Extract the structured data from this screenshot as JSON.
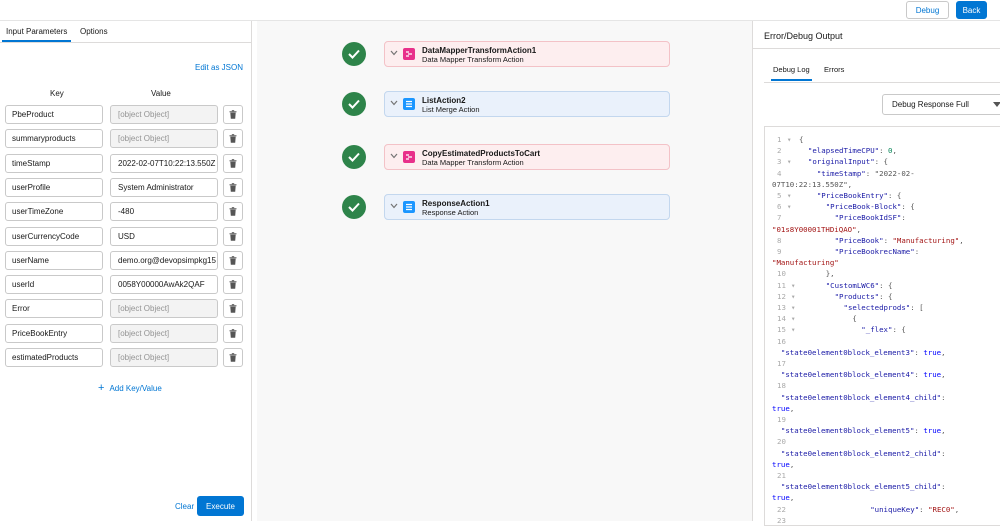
{
  "topbar": {
    "debug_label": "Debug",
    "back_label": "Back"
  },
  "left": {
    "tabs": [
      "Input Parameters",
      "Options"
    ],
    "edit_json": "Edit as JSON",
    "key_header": "Key",
    "value_header": "Value",
    "rows": [
      {
        "key": "PbeProduct",
        "value": "[object Object]"
      },
      {
        "key": "summaryproducts",
        "value": "[object Object]"
      },
      {
        "key": "timeStamp",
        "value": "2022-02-07T10:22:13.550Z"
      },
      {
        "key": "userProfile",
        "value": "System Administrator"
      },
      {
        "key": "userTimeZone",
        "value": "-480"
      },
      {
        "key": "userCurrencyCode",
        "value": "USD"
      },
      {
        "key": "userName",
        "value": "demo.org@devopsimpkg15"
      },
      {
        "key": "userId",
        "value": "0058Y00000AwAk2QAF"
      },
      {
        "key": "Error",
        "value": "[object Object]"
      },
      {
        "key": "PriceBookEntry",
        "value": "[object Object]"
      },
      {
        "key": "estimatedProducts",
        "value": "[object Object]"
      }
    ],
    "add_label": "Add Key/Value",
    "clear_label": "Clear",
    "execute_label": "Execute"
  },
  "steps": [
    {
      "title": "DataMapperTransformAction1",
      "subtitle": "Data Mapper Transform Action",
      "kind": "pink"
    },
    {
      "title": "ListAction2",
      "subtitle": "List Merge Action",
      "kind": "blue"
    },
    {
      "title": "CopyEstimatedProductsToCart",
      "subtitle": "Data Mapper Transform Action",
      "kind": "pink"
    },
    {
      "title": "ResponseAction1",
      "subtitle": "Response Action",
      "kind": "blue"
    }
  ],
  "right": {
    "title": "Error/Debug Output",
    "tabs": [
      "Debug Log",
      "Errors"
    ],
    "select_value": "Debug Response Full",
    "code": [
      {
        "n": "1",
        "f": "▾",
        "t": "{"
      },
      {
        "n": "2",
        "f": "",
        "t": "  \"elapsedTimeCPU\": 0,"
      },
      {
        "n": "3",
        "f": "▾",
        "t": "  \"originalInput\": {"
      },
      {
        "n": "4",
        "f": "",
        "t": "    \"timeStamp\": \"2022-02-"
      },
      {
        "n": "",
        "f": "",
        "t": "07T10:22:13.550Z\","
      },
      {
        "n": "5",
        "f": "▾",
        "t": "    \"PriceBookEntry\": {"
      },
      {
        "n": "6",
        "f": "▾",
        "t": "      \"PriceBook-Block\": {"
      },
      {
        "n": "7",
        "f": "",
        "t": "        \"PriceBookIdSF\":"
      },
      {
        "n": "",
        "f": "",
        "t": "\"01s8Y00001THDiQAO\","
      },
      {
        "n": "8",
        "f": "",
        "t": "        \"PriceBook\": \"Manufacturing\","
      },
      {
        "n": "9",
        "f": "",
        "t": "        \"PriceBookrecName\":"
      },
      {
        "n": "",
        "f": "",
        "t": "\"Manufacturing\""
      },
      {
        "n": "10",
        "f": "",
        "t": "      },"
      },
      {
        "n": "11",
        "f": "▾",
        "t": "      \"CustomLWC6\": {"
      },
      {
        "n": "12",
        "f": "▾",
        "t": "        \"Products\": {"
      },
      {
        "n": "13",
        "f": "▾",
        "t": "          \"selectedprods\": ["
      },
      {
        "n": "14",
        "f": "▾",
        "t": "            {"
      },
      {
        "n": "15",
        "f": "▾",
        "t": "              \"_flex\": {"
      },
      {
        "n": "16",
        "f": "",
        "t": ""
      },
      {
        "n": "",
        "f": "",
        "t": "  \"state0element0block_element3\": true,"
      },
      {
        "n": "17",
        "f": "",
        "t": ""
      },
      {
        "n": "",
        "f": "",
        "t": "  \"state0element0block_element4\": true,"
      },
      {
        "n": "18",
        "f": "",
        "t": ""
      },
      {
        "n": "",
        "f": "",
        "t": "  \"state0element0block_element4_child\":"
      },
      {
        "n": "",
        "f": "",
        "t": "true,"
      },
      {
        "n": "19",
        "f": "",
        "t": ""
      },
      {
        "n": "",
        "f": "",
        "t": "  \"state0element0block_element5\": true,"
      },
      {
        "n": "20",
        "f": "",
        "t": ""
      },
      {
        "n": "",
        "f": "",
        "t": "  \"state0element0block_element2_child\":"
      },
      {
        "n": "",
        "f": "",
        "t": "true,"
      },
      {
        "n": "21",
        "f": "",
        "t": ""
      },
      {
        "n": "",
        "f": "",
        "t": "  \"state0element0block_element5_child\":"
      },
      {
        "n": "",
        "f": "",
        "t": "true,"
      },
      {
        "n": "22",
        "f": "",
        "t": "                \"uniqueKey\": \"REC0\","
      },
      {
        "n": "23",
        "f": "",
        "t": ""
      }
    ]
  },
  "colors": {
    "brand": "#0176d3",
    "success": "#2e844a",
    "pink_icon": "#e8308a",
    "blue_icon": "#1b96ff"
  }
}
